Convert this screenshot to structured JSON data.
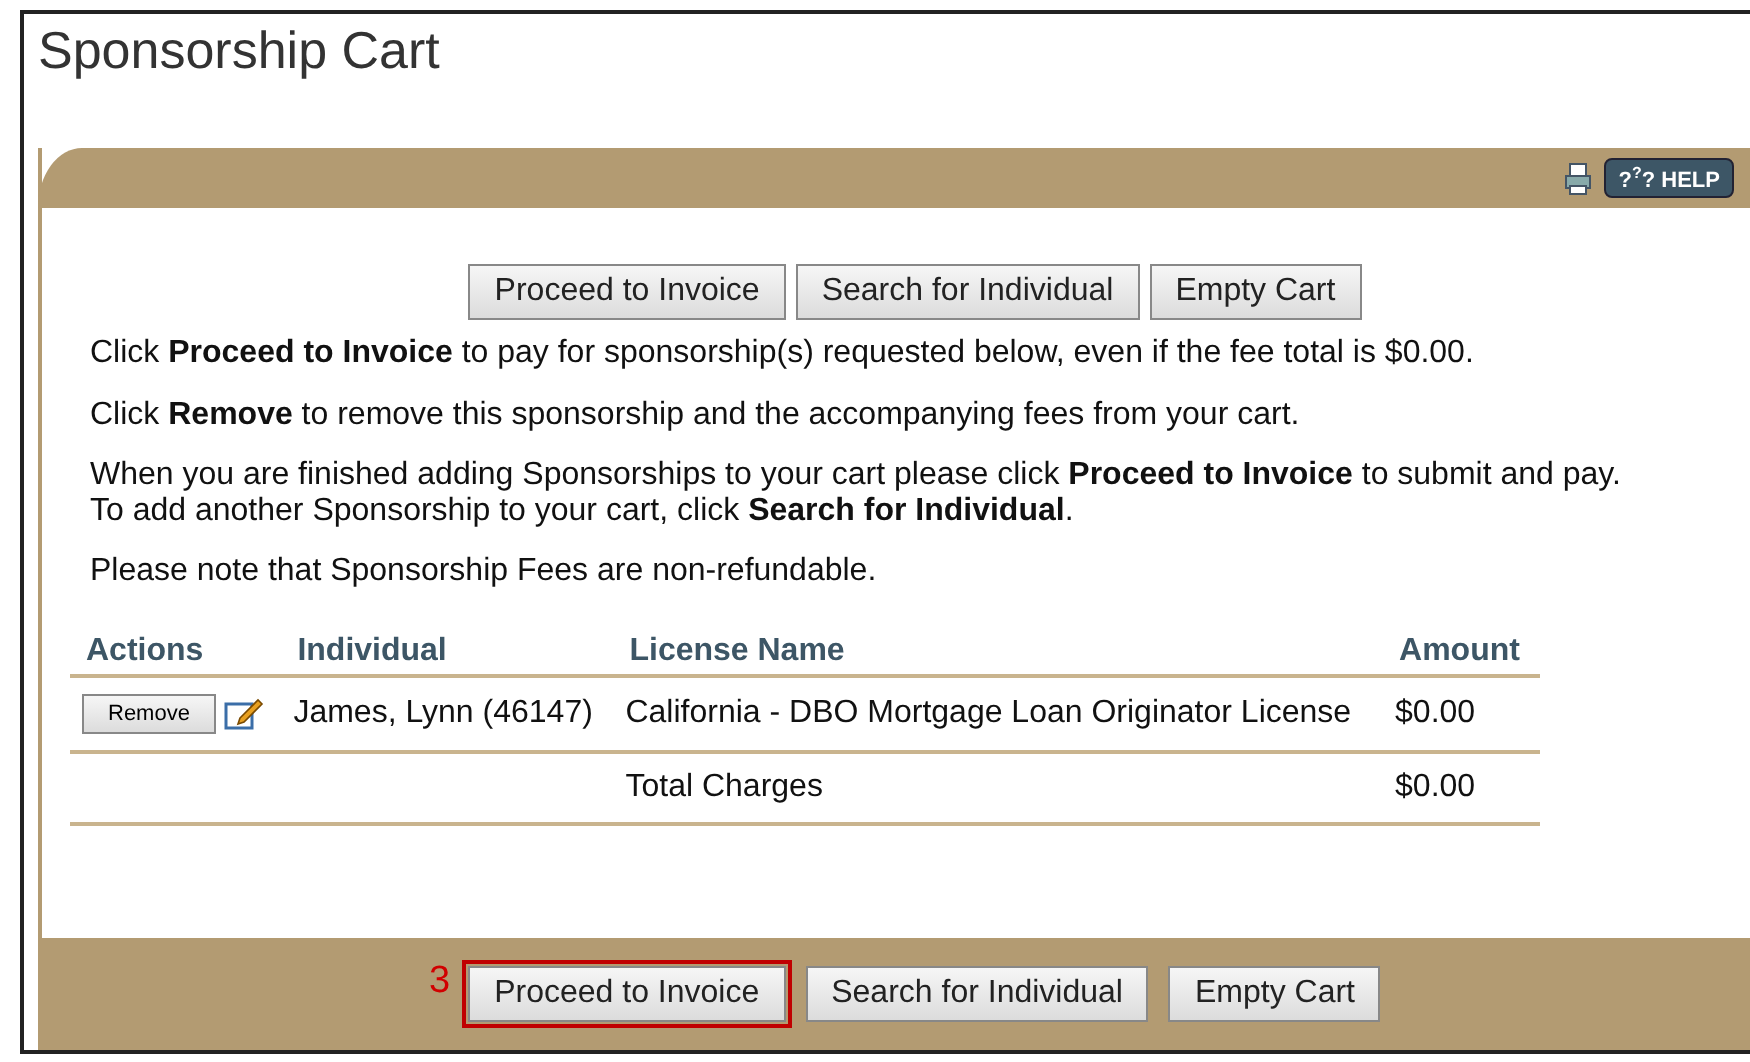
{
  "title": "Sponsorship Cart",
  "header_bar": {
    "help_label": "HELP",
    "help_glyph": "?"
  },
  "top_buttons": [
    {
      "label": "Proceed to Invoice"
    },
    {
      "label": "Search for Individual"
    },
    {
      "label": "Empty Cart"
    }
  ],
  "paragraphs": [
    "Click **Proceed to Invoice** to pay for sponsorship(s) requested below, even if the fee total is $0.00.",
    "Click **Remove** to remove this sponsorship and the accompanying fees from your cart.",
    "When you are finished adding Sponsorships to your cart please click **Proceed to Invoice** to submit and pay.\nTo add another Sponsorship to your cart, click **Search for Individual**.",
    "Please note that Sponsorship Fees are non-refundable."
  ],
  "table": {
    "columns": [
      "Actions",
      "Individual",
      "License Name",
      "Amount"
    ],
    "rows": [
      {
        "action": "Remove",
        "individual": "James, Lynn (46147)",
        "license": "California - DBO Mortgage Loan Originator License",
        "amount": "$0.00"
      }
    ],
    "total": {
      "label": "Total Charges",
      "amount": "$0.00"
    }
  },
  "bottom_buttons": [
    {
      "label": "Proceed to Invoice",
      "highlighted": true,
      "callout": "3"
    },
    {
      "label": "Search for Individual",
      "highlighted": false
    },
    {
      "label": "Empty Cart",
      "highlighted": false
    }
  ]
}
